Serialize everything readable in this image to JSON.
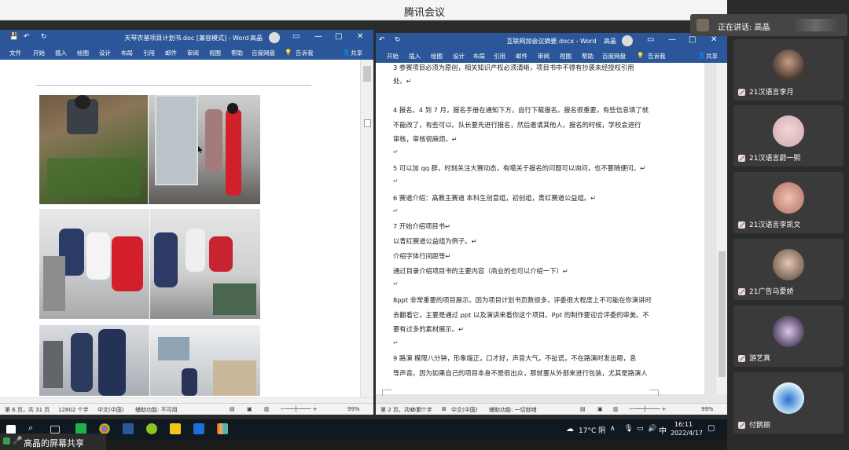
{
  "app_title": "腾讯会议",
  "speaker": {
    "label": "正在讲话: 高晶"
  },
  "share_label": "高晶的屏幕共享",
  "left_word": {
    "doc_title": "天琴农基项目计划书.doc [兼容模式] - Word",
    "user": "高晶",
    "tabs": [
      "文件",
      "开始",
      "插入",
      "绘图",
      "设计",
      "布局",
      "引用",
      "邮件",
      "审阅",
      "视图",
      "帮助",
      "百度网盘"
    ],
    "tell_me": "告诉我",
    "share": "共享",
    "status": {
      "page": "第 6 页，共 31 页",
      "words": "12802 个字",
      "lang": "中文(中国)",
      "accessibility": "辅助功能: 不可用",
      "zoom": "99%"
    }
  },
  "right_word": {
    "doc_title": "互联网加会议摘要.docx - Word",
    "user": "高晶",
    "tabs": [
      "开始",
      "插入",
      "绘图",
      "设计",
      "布局",
      "引用",
      "邮件",
      "审阅",
      "视图",
      "帮助",
      "百度网盘"
    ],
    "tell_me": "告诉我",
    "share": "共享",
    "status": {
      "page": "第 2 页，共 2 页",
      "words": "903 个字",
      "lang": "中文(中国)",
      "accessibility": "辅助功能: 一切就绪",
      "zoom": "99%"
    },
    "paragraphs": [
      "3 参赛项目必须为原创，相关知识产权必须清晰，项目书中不得有抄袭未经授权引用",
      "处。↵",
      "4 报名。4 到 7 月，报名手册在通知下方，自行下载报名。报名很重要，有些信息填了就",
      "不能改了，有些可以。队长要先进行报名，然后邀请其他人。报名的时候，学校会进行",
      "审核，审核很麻烦。↵",
      "5 可以加 qq 群，时刻关注大赛动态，有噶关于报名的问题可以询问，也不要随便问。↵",
      "6 赛道介绍：高教主赛道  本科生创意组，初创组，青红赛道公益组。↵",
      "7 开始介绍项目书↵",
      "以青红赛道公益组为例子。↵",
      "介绍字体行间距等↵",
      "通过目录介绍项目书的主要内容（商业的也可以介绍一下）↵",
      "8ppt 非常重要的项目展示。因为项目计划书页数很多，评委很大程度上不可能在你演讲时",
      "去翻看它，主要是通过 ppt 以及演讲来看你这个项目。Ppt 的制作要迎合评委的审美。不",
      "要有过多的素材展示。↵",
      "9 路演       模限八分钟，形象端正，口才好，声音大气，不扯谎，不在路演时发出嗯，息",
      "等声音。因为如果自己的项目本身不是很出众，那就要从外部来进行包装，尤其是路演人"
    ]
  },
  "participants": [
    {
      "name": "21汉语言李月"
    },
    {
      "name": "21汉语言蔚一熙"
    },
    {
      "name": "21汉语言李凯文"
    },
    {
      "name": "21广告马愛娇"
    },
    {
      "name": "游艺真"
    },
    {
      "name": "付鹅丽"
    }
  ],
  "taskbar": {
    "weather": "17°C 阴",
    "ime": "中",
    "time": "16:11",
    "date": "2022/4/17"
  }
}
